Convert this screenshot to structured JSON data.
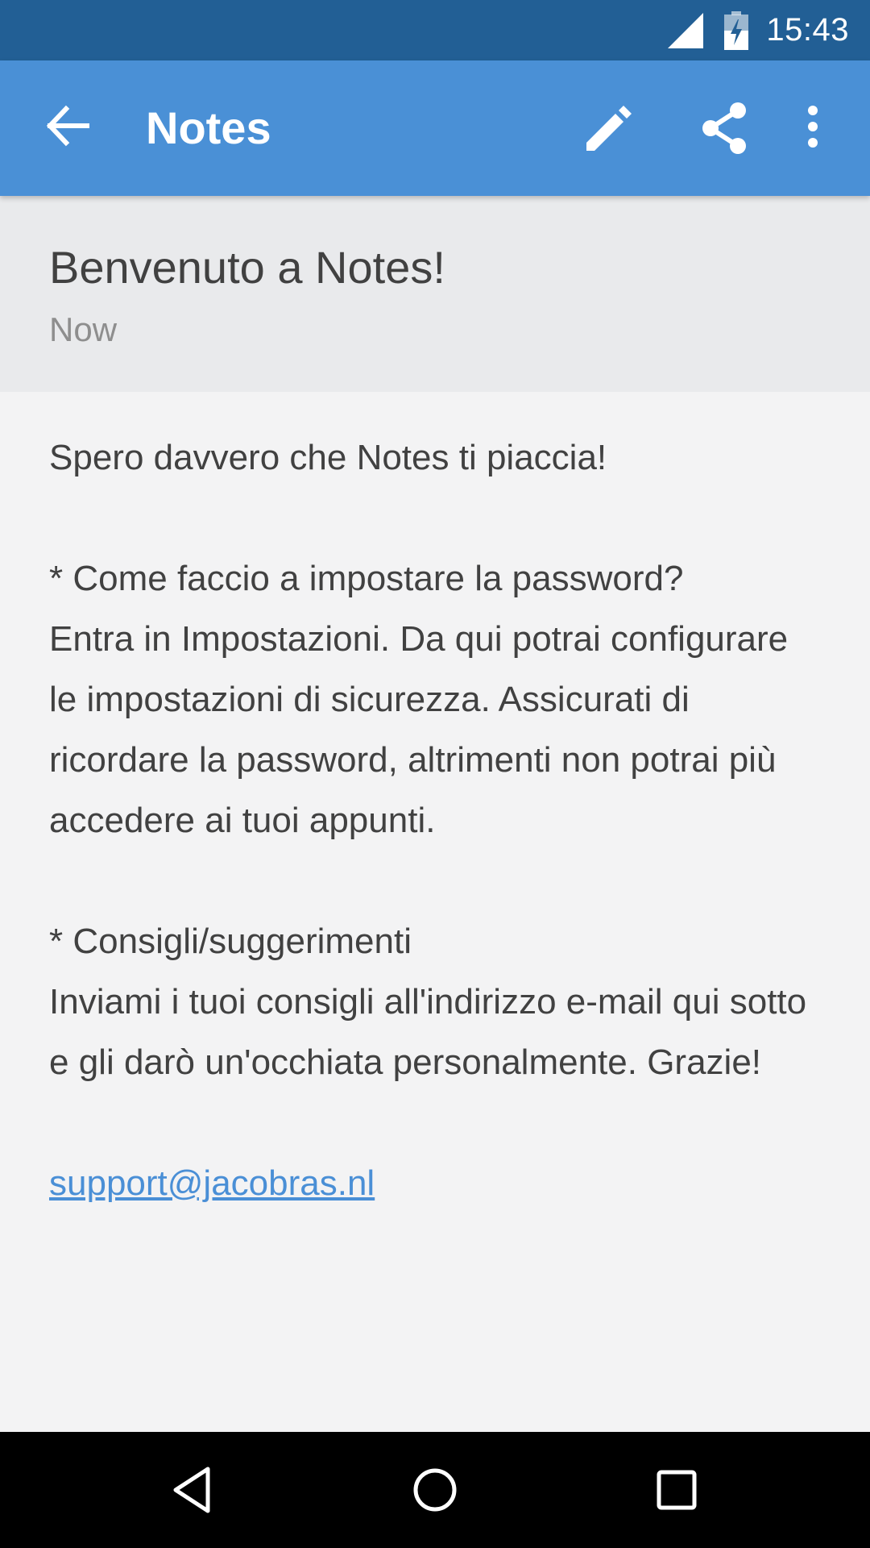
{
  "status_bar": {
    "time": "15:43",
    "icons": [
      "cell-signal-icon",
      "battery-charging-icon"
    ]
  },
  "app_bar": {
    "title": "Notes",
    "icons": [
      "arrow-back-icon",
      "pencil-edit-icon",
      "share-icon",
      "more-vert-icon"
    ]
  },
  "note": {
    "title": "Benvenuto a Notes!",
    "date": "Now",
    "intro": "Spero davvero che Notes ti piaccia!",
    "section1_heading": "* Come faccio a impostare la password?",
    "section1_text": "Entra in Impostazioni. Da qui potrai configurare le impostazioni di sicurezza. Assicurati di ricordare la password, altrimenti non potrai più accedere ai tuoi appunti.",
    "section2_heading": "* Consigli/suggerimenti",
    "section2_text": "Inviami i tuoi consigli all'indirizzo e-mail qui sotto e gli darò un'occhiata personalmente. Grazie!",
    "email": "support@jacobras.nl"
  },
  "nav_bar": {
    "icons": [
      "nav-back-icon",
      "nav-home-icon",
      "nav-recents-icon"
    ]
  },
  "colors": {
    "status_bar": "#225f95",
    "app_bar": "#4a90d6",
    "header_bg": "#e9eaec",
    "body_bg": "#f3f3f4",
    "link": "#4a8fd6"
  }
}
